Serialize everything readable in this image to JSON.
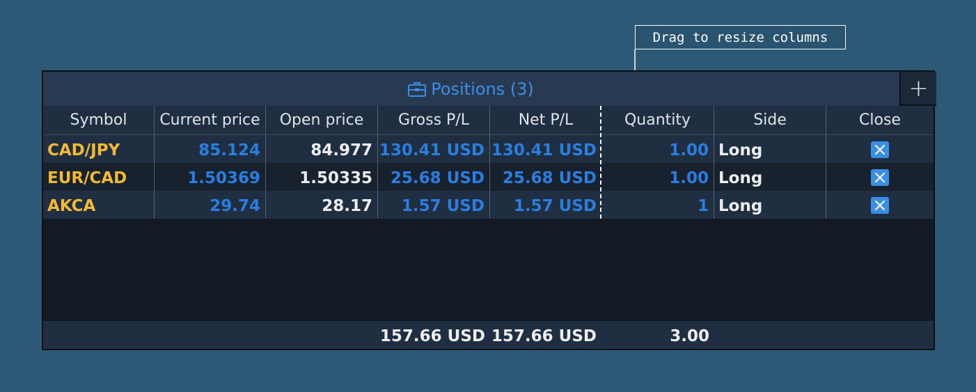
{
  "callout": {
    "text": "Drag to resize columns"
  },
  "panel": {
    "title": "Positions (3)",
    "add_label": "+"
  },
  "columns": [
    "Symbol",
    "Current price",
    "Open price",
    "Gross P/L",
    "Net P/L",
    "Quantity",
    "Side",
    "Close"
  ],
  "rows": [
    {
      "symbol": "CAD/JPY",
      "current_price": "85.124",
      "open_price": "84.977",
      "gross_pl": "130.41 USD",
      "net_pl": "130.41 USD",
      "quantity": "1.00",
      "side": "Long"
    },
    {
      "symbol": "EUR/CAD",
      "current_price": "1.50369",
      "open_price": "1.50335",
      "gross_pl": "25.68 USD",
      "net_pl": "25.68 USD",
      "quantity": "1.00",
      "side": "Long"
    },
    {
      "symbol": "AKCA",
      "current_price": "29.74",
      "open_price": "28.17",
      "gross_pl": "1.57 USD",
      "net_pl": "1.57 USD",
      "quantity": "1",
      "side": "Long"
    }
  ],
  "totals": {
    "gross_pl": "157.66 USD",
    "net_pl": "157.66 USD",
    "quantity": "3.00"
  },
  "icons": {
    "panel": "briefcase-icon",
    "add": "plus-icon",
    "close": "close-x-icon"
  },
  "colors": {
    "background": "#2d5977",
    "header_bg": "#283a52",
    "accent_blue": "#2a7ee0",
    "symbol_yellow": "#f2b935",
    "close_button": "#3a8ee3"
  }
}
